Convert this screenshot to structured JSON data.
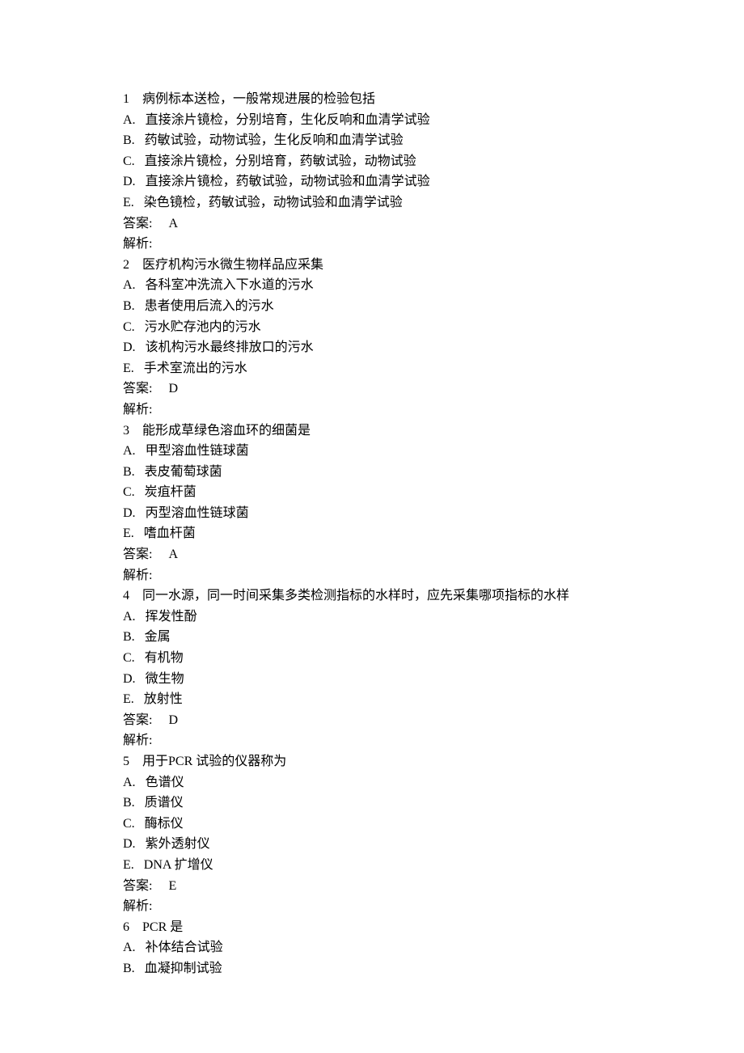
{
  "questions": [
    {
      "num": "1",
      "text": "病例标本送检，一般常规进展的检验包括",
      "options": [
        {
          "label": "A.",
          "text": "直接涂片镜检，分别培育，生化反响和血清学试验"
        },
        {
          "label": "B.",
          "text": "药敏试验，动物试验，生化反响和血清学试验"
        },
        {
          "label": "C.",
          "text": "直接涂片镜检，分别培育，药敏试验，动物试验"
        },
        {
          "label": "D.",
          "text": "直接涂片镜检，药敏试验，动物试验和血清学试验"
        },
        {
          "label": "E.",
          "text": "染色镜检，药敏试验，动物试验和血清学试验"
        }
      ],
      "answerLabel": "答案:",
      "answer": "A",
      "explLabel": "解析:"
    },
    {
      "num": "2",
      "text": "医疗机构污水微生物样品应采集",
      "options": [
        {
          "label": "A.",
          "text": "各科室冲洗流入下水道的污水"
        },
        {
          "label": "B.",
          "text": "患者使用后流入的污水"
        },
        {
          "label": "C.",
          "text": "污水贮存池内的污水"
        },
        {
          "label": "D.",
          "text": "该机构污水最终排放口的污水"
        },
        {
          "label": "E.",
          "text": "手术室流出的污水"
        }
      ],
      "answerLabel": "答案:",
      "answer": "D",
      "explLabel": "解析:"
    },
    {
      "num": "3",
      "text": "能形成草绿色溶血环的细菌是",
      "options": [
        {
          "label": "A.",
          "text": "甲型溶血性链球菌"
        },
        {
          "label": "B.",
          "text": "表皮葡萄球菌"
        },
        {
          "label": "C.",
          "text": "炭疽杆菌"
        },
        {
          "label": "D.",
          "text": "丙型溶血性链球菌"
        },
        {
          "label": "E.",
          "text": "嗜血杆菌"
        }
      ],
      "answerLabel": "答案:",
      "answer": "A",
      "explLabel": "解析:"
    },
    {
      "num": "4",
      "text": "同一水源，同一时间采集多类检测指标的水样时，应先采集哪项指标的水样",
      "options": [
        {
          "label": "A.",
          "text": "挥发性酚"
        },
        {
          "label": "B.",
          "text": "金属"
        },
        {
          "label": "C.",
          "text": "有机物"
        },
        {
          "label": "D.",
          "text": "微生物"
        },
        {
          "label": "E.",
          "text": "放射性"
        }
      ],
      "answerLabel": "答案:",
      "answer": "D",
      "explLabel": "解析:"
    },
    {
      "num": "5",
      "text": "用于PCR 试验的仪器称为",
      "options": [
        {
          "label": "A.",
          "text": "色谱仪"
        },
        {
          "label": "B.",
          "text": "质谱仪"
        },
        {
          "label": "C.",
          "text": "酶标仪"
        },
        {
          "label": "D.",
          "text": "紫外透射仪"
        },
        {
          "label": "E.",
          "text": "DNA 扩增仪"
        }
      ],
      "answerLabel": "答案:",
      "answer": "E",
      "explLabel": "解析:"
    },
    {
      "num": "6",
      "text": "PCR 是",
      "options": [
        {
          "label": "A.",
          "text": "补体结合试验"
        },
        {
          "label": "B.",
          "text": "血凝抑制试验"
        }
      ],
      "answerLabel": "",
      "answer": "",
      "explLabel": ""
    }
  ]
}
